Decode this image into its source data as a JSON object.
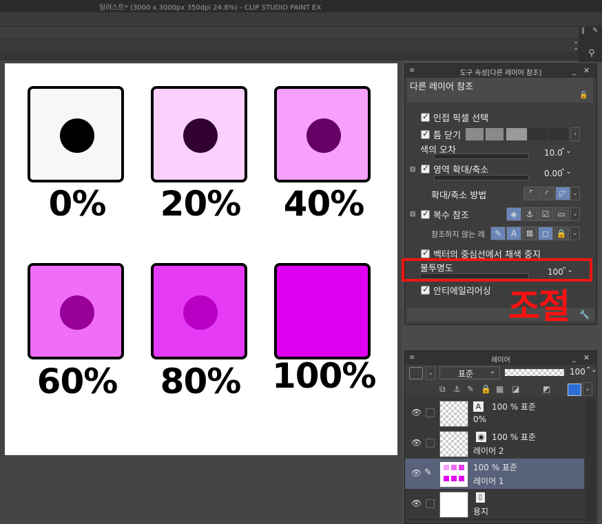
{
  "window": {
    "title": "일러스트* (3000 x 3000px 350dpi 24.8%)  - CLIP STUDIO PAINT EX"
  },
  "canvas": {
    "swatches": [
      {
        "label": "0%",
        "box_color": "#f7f7f7",
        "dot_color": "#000000"
      },
      {
        "label": "20%",
        "box_color": "#fbd0fd",
        "dot_color": "#330033"
      },
      {
        "label": "40%",
        "box_color": "#f7a0fb",
        "dot_color": "#660066"
      },
      {
        "label": "60%",
        "box_color": "#f06df8",
        "dot_color": "#990099"
      },
      {
        "label": "80%",
        "box_color": "#e53bf5",
        "dot_color": "#b800c4"
      },
      {
        "label": "100%",
        "box_color": "#df00f2",
        "dot_color": "#df00f2"
      }
    ]
  },
  "tool_property": {
    "panel_title": "도구 속성[다른 레이어 참조]",
    "subtool_name": "다른 레이어 참조",
    "rows": {
      "adjacent_pixel": "인접 픽셀 선택",
      "close_gap": "틈 닫기",
      "color_tolerance": {
        "label": "색의 오차",
        "value": "10.0"
      },
      "area_scaling": {
        "label": "영역 확대/축소",
        "value": "0.00"
      },
      "scaling_method": "확대/축소 방법",
      "multi_reference": "복수 참조",
      "no_reference_layer": "참조하지 않는 레",
      "vector_center": "벡터의 중심선에서 채색 중지",
      "opacity": {
        "label": "불투명도",
        "value": "100"
      },
      "antialias": "안티에일리어싱"
    }
  },
  "annotation": {
    "label": "조절",
    "color": "#ff1010"
  },
  "layer_panel": {
    "title": "레이어",
    "blend_mode": "표준",
    "opacity_value": "100",
    "layers": [
      {
        "top": "100 % 표준",
        "name": "0%",
        "selected": false,
        "icon": "text-layer-icon"
      },
      {
        "top": "100 % 표준",
        "name": "레이어 2",
        "selected": false,
        "icon": "layer-2-icon"
      },
      {
        "top": "100 % 표준",
        "name": "레이어 1",
        "selected": true,
        "icon": "pen-icon"
      },
      {
        "top": "",
        "name": "용지",
        "selected": false,
        "icon": "paper-icon"
      }
    ]
  }
}
